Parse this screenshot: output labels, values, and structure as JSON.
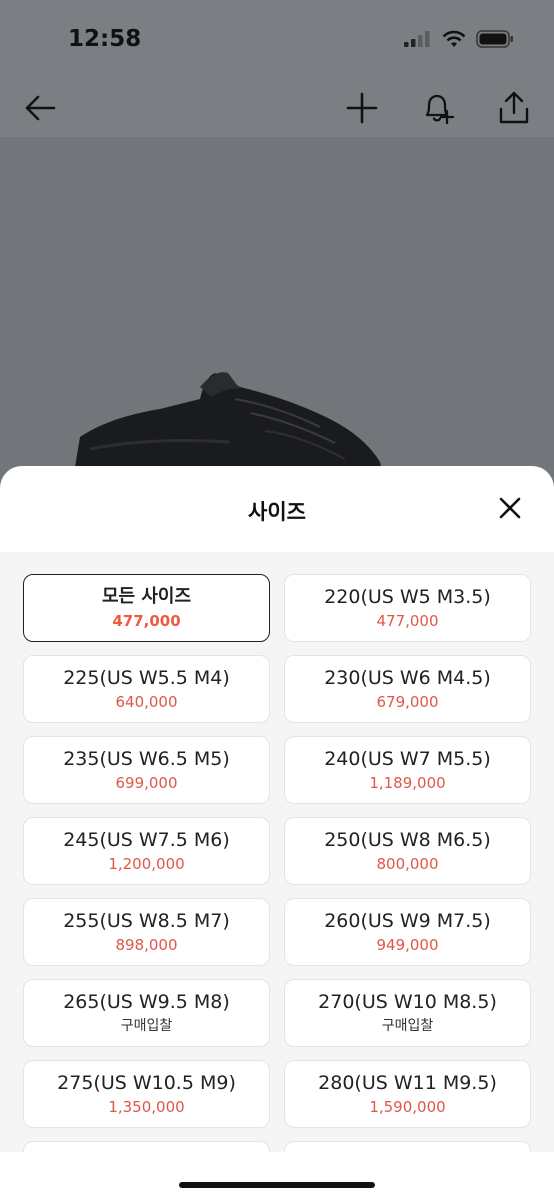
{
  "status_bar": {
    "time": "12:58"
  },
  "sheet": {
    "title": "사이즈",
    "sizes": [
      {
        "label": "모든 사이즈",
        "price": "477,000"
      },
      {
        "label": "220(US W5 M3.5)",
        "price": "477,000"
      },
      {
        "label": "225(US W5.5 M4)",
        "price": "640,000"
      },
      {
        "label": "230(US W6 M4.5)",
        "price": "679,000"
      },
      {
        "label": "235(US W6.5 M5)",
        "price": "699,000"
      },
      {
        "label": "240(US W7 M5.5)",
        "price": "1,189,000"
      },
      {
        "label": "245(US W7.5 M6)",
        "price": "1,200,000"
      },
      {
        "label": "250(US W8 M6.5)",
        "price": "800,000"
      },
      {
        "label": "255(US W8.5 M7)",
        "price": "898,000"
      },
      {
        "label": "260(US W9 M7.5)",
        "price": "949,000"
      },
      {
        "label": "265(US W9.5 M8)",
        "price": "구매입찰"
      },
      {
        "label": "270(US W10 M8.5)",
        "price": "구매입찰"
      },
      {
        "label": "275(US W10.5 M9)",
        "price": "1,350,000"
      },
      {
        "label": "280(US W11 M9.5)",
        "price": "1,590,000"
      },
      {
        "label": "",
        "price": ""
      },
      {
        "label": "",
        "price": ""
      }
    ]
  },
  "icons": {
    "back": "arrow-left-icon",
    "add": "plus-icon",
    "alert": "bell-plus-icon",
    "share": "share-icon",
    "close": "close-icon"
  },
  "colors": {
    "price": "#e0574a",
    "selected_price": "#ef5a42",
    "selected_border": "#222222"
  }
}
